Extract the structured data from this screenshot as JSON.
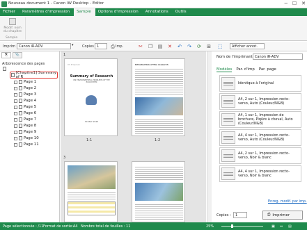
{
  "window": {
    "title": "Nouveau document 1 - Canon iW Desktop - Editor",
    "minimize": "─",
    "maximize": "☐",
    "close": "✕"
  },
  "menu": {
    "tabs": [
      "Fichier",
      "Paramètres d'impression",
      "Sample",
      "Options d'impression",
      "Annotations",
      "Outils"
    ],
    "active": 2
  },
  "ribbon": {
    "button_label": "Modif. nom du chapitre",
    "group_label": "Sample"
  },
  "toolbar": {
    "printer_label": "Imprim :",
    "printer_value": "Canon iR-ADV",
    "copies_label": "Copies :",
    "copies_value": "1",
    "imp_label": "Imp.",
    "annotations_button": "Afficher annot."
  },
  "left_panel": {
    "tree_title": "Arborescence des pages",
    "chapter_label": "[Chapitre1] Summary of R",
    "pages": [
      "Page 1",
      "Page 2",
      "Page 3",
      "Page 4",
      "Page 5",
      "Page 6",
      "Page 7",
      "Page 8",
      "Page 9",
      "Page 10",
      "Page 11"
    ]
  },
  "canvas": {
    "groups": [
      "1",
      "3"
    ],
    "thumb_labels": [
      "1-1",
      "1-2"
    ],
    "doc_title": "Summary of Research",
    "doc_subtitle": "ON ENVIRONMENTAL PROBLEMS OF THE ECOSYSTEM",
    "doc_date": "30 MAY 2023",
    "page2_heading": "Introduction of the research"
  },
  "right_panel": {
    "printer_name_label": "Nom de l'imprimante :",
    "printer_name_value": "Canon iR-ADV",
    "tabs": [
      "Modèles",
      "Par. d'imp",
      "Par. page"
    ],
    "presets": [
      {
        "label": "Identique à l'original"
      },
      {
        "label": "A4, 2 sur 1, Impression recto-verso, Auto (Couleur/N&B)"
      },
      {
        "label": "A4, 1 sur 1, Impression de brochure, Piqûre à cheval, Auto (Couleur/N&B)"
      },
      {
        "label": "A4, 4 sur 1, Impression recto-verso, Auto (Couleur/N&B)"
      },
      {
        "label": "A4, 2 sur 1, Impression recto-verso, Noir & blanc"
      },
      {
        "label": "A4, 4 sur 1, Impression recto-verso, Noir & blanc"
      }
    ],
    "link": "Enreg. modif. par imp.",
    "copies_label": "Copies :",
    "copies_value": "1",
    "print_button": "Imprimer"
  },
  "status": {
    "selected": "Page sélectionnée : /11",
    "format": "Format de sortie:A4",
    "sheets": "Nombre total de feuilles : 11",
    "zoom": "25%"
  },
  "colors": {
    "accent": "#1f8a4c",
    "highlight": "#e53935"
  }
}
